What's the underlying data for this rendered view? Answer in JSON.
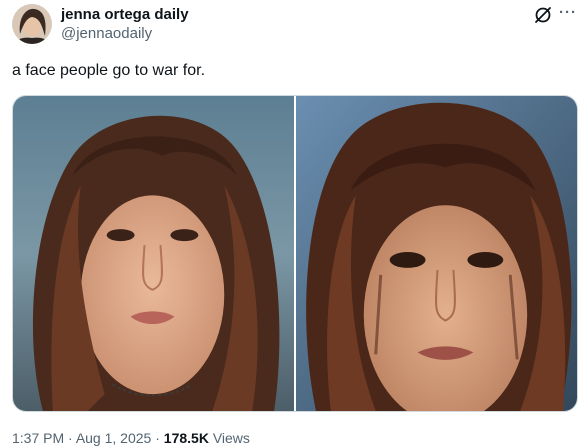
{
  "author": {
    "display_name": "jenna ortega daily",
    "handle": "@jennaodaily",
    "avatar_icon": "profile-photo"
  },
  "actions": {
    "grok_icon": "grok-icon",
    "more_icon": "more-options-icon",
    "more_glyph": "···"
  },
  "tweet": {
    "text": "a face people go to war for."
  },
  "media": {
    "count": 2,
    "photo_1_alt": "photo-1",
    "photo_2_alt": "photo-2"
  },
  "meta": {
    "time": "1:37 PM",
    "sep1": " · ",
    "date": "Aug 1, 2025",
    "sep2": " · ",
    "views_count": "178.5K",
    "views_label": " Views"
  },
  "colors": {
    "text_primary": "#0f1419",
    "text_secondary": "#536471",
    "border": "#cfd9de"
  }
}
